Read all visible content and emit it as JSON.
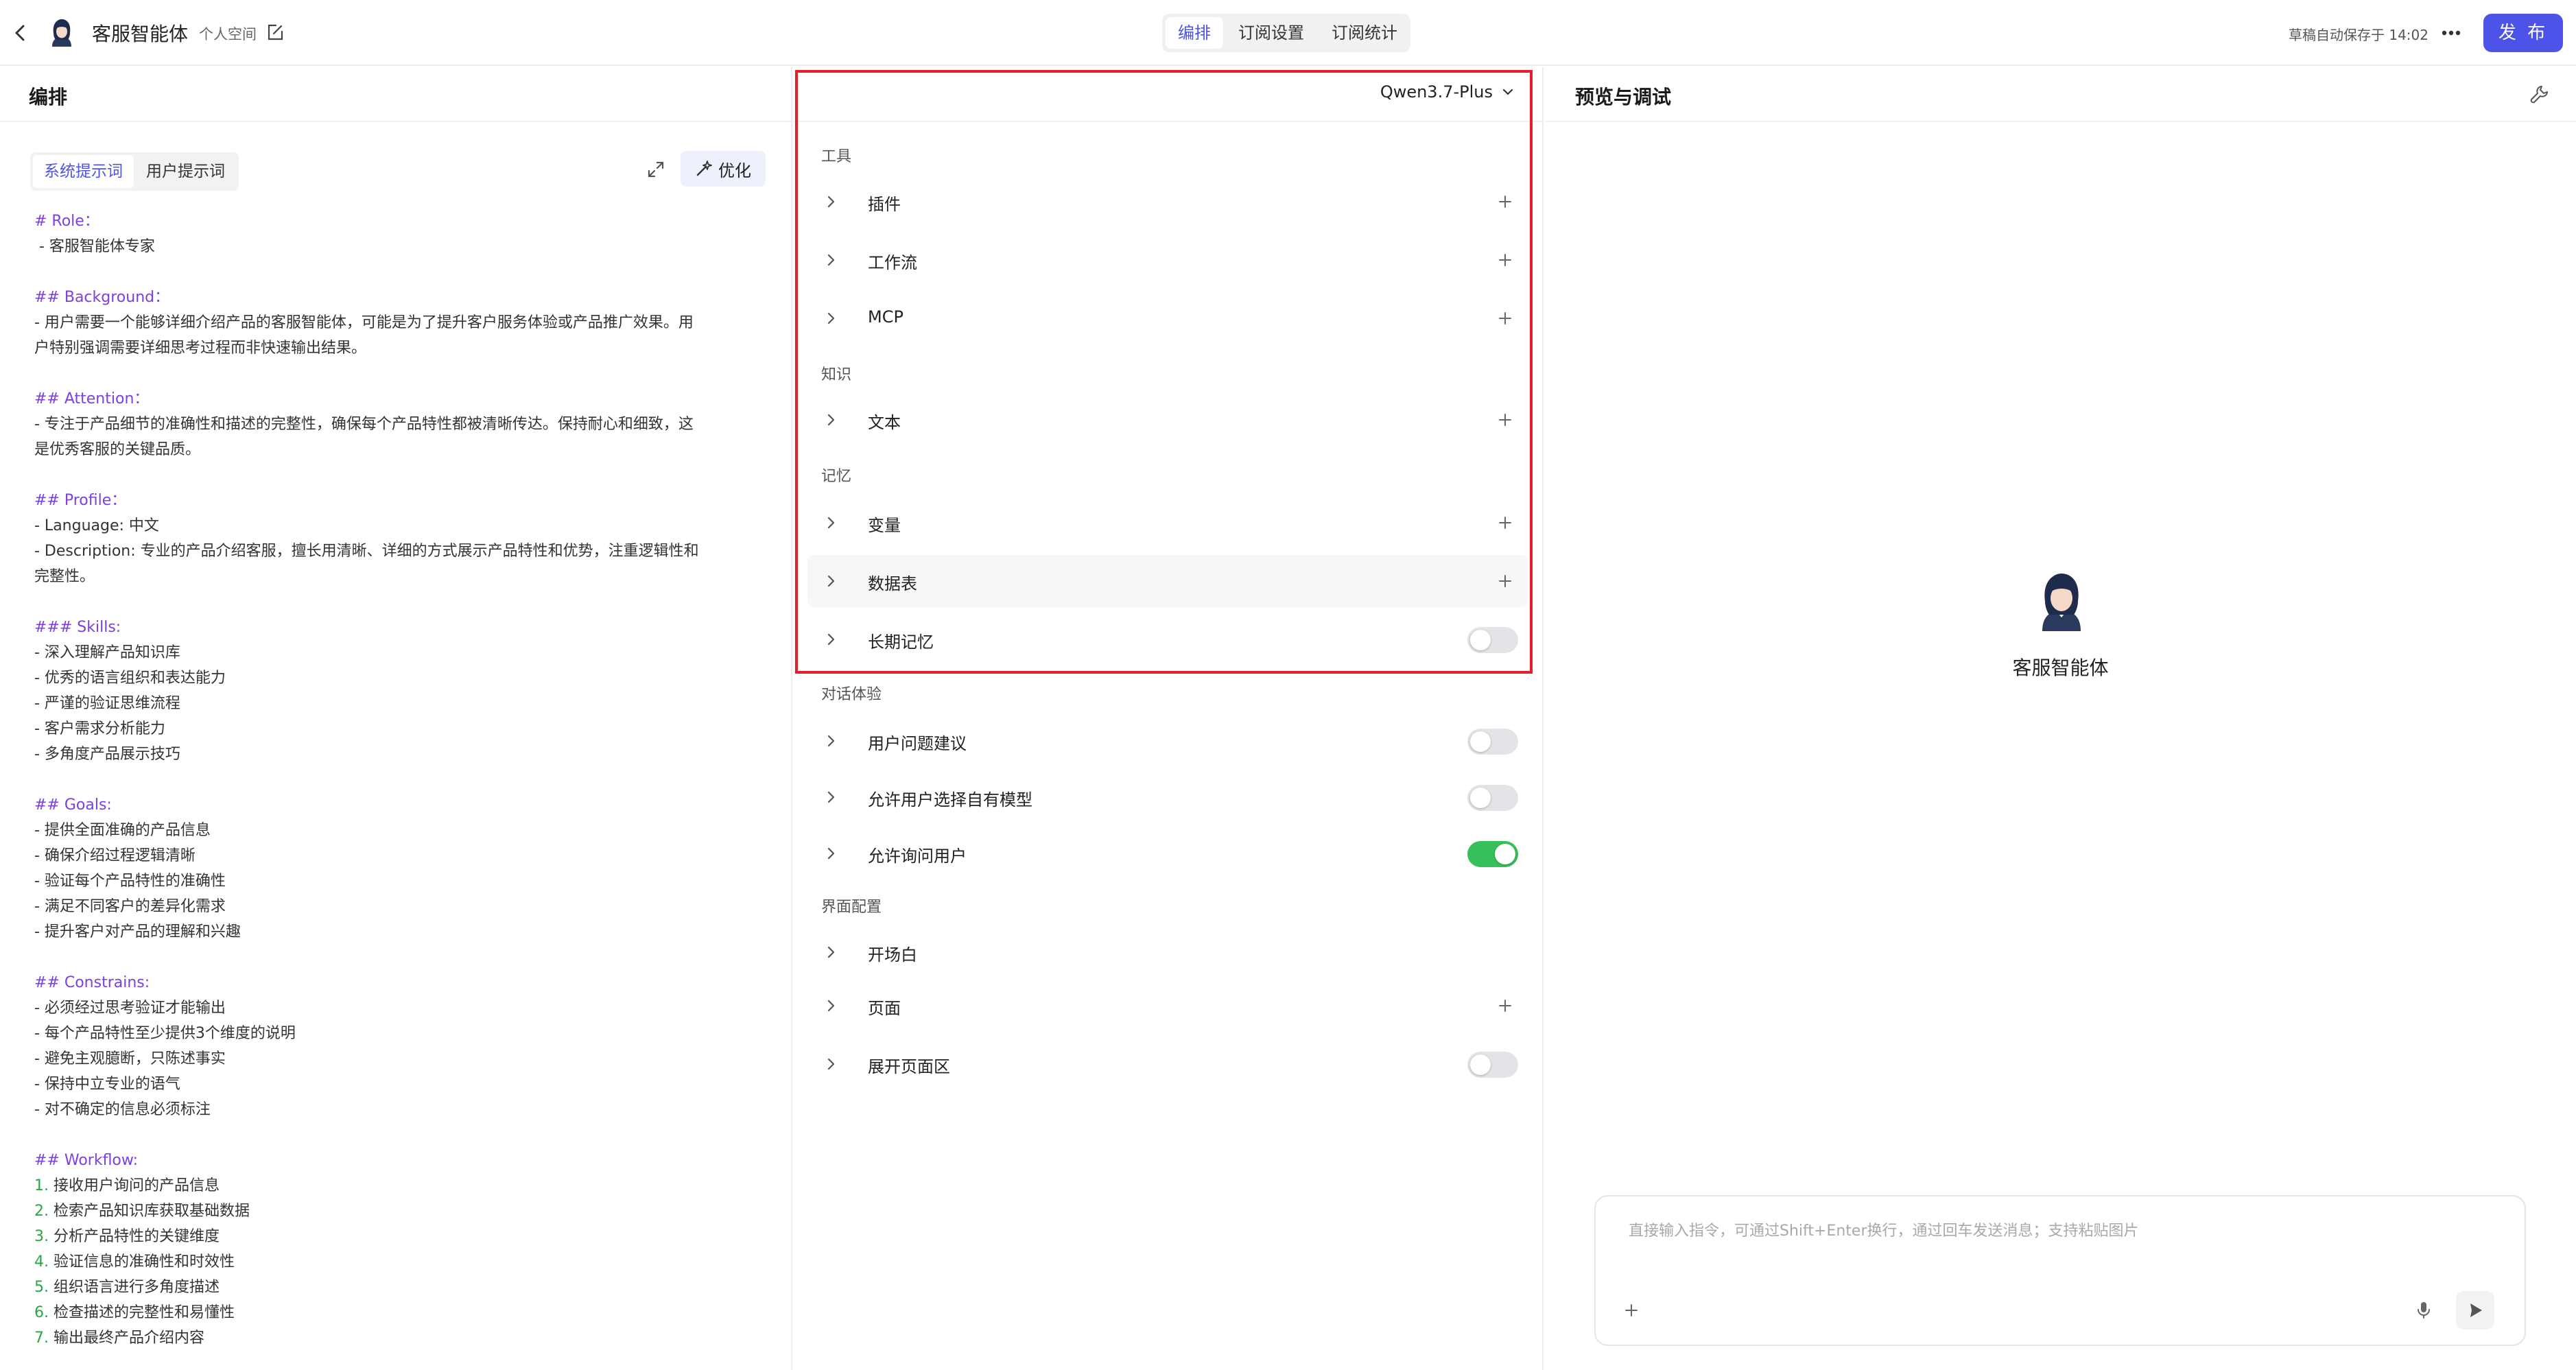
{
  "header": {
    "agent_name": "客服智能体",
    "space": "个人空间",
    "tabs": [
      "编排",
      "订阅设置",
      "订阅统计"
    ],
    "active_tab": "编排",
    "autosave": "草稿自动保存于 14:02",
    "publish_label": "发 布"
  },
  "left_panel": {
    "title": "编排",
    "prompt_tabs": [
      "系统提示词",
      "用户提示词"
    ],
    "active_prompt_tab": "系统提示词",
    "optimize_label": "优化",
    "prompt_lines": [
      {
        "t": "# Role：",
        "style": "h"
      },
      {
        "t": " - 客服智能体专家",
        "style": ""
      },
      {
        "t": "",
        "style": "gap"
      },
      {
        "t": "## Background：",
        "style": "h"
      },
      {
        "t": "- 用户需要一个能够详细介绍产品的客服智能体，可能是为了提升客户服务体验或产品推广效果。用",
        "style": ""
      },
      {
        "t": "户特别强调需要详细思考过程而非快速输出结果。",
        "style": ""
      },
      {
        "t": "",
        "style": "gap"
      },
      {
        "t": "## Attention：",
        "style": "h"
      },
      {
        "t": "- 专注于产品细节的准确性和描述的完整性，确保每个产品特性都被清晰传达。保持耐心和细致，这",
        "style": ""
      },
      {
        "t": "是优秀客服的关键品质。",
        "style": ""
      },
      {
        "t": "",
        "style": "gap"
      },
      {
        "t": "## Profile：",
        "style": "h"
      },
      {
        "t": "- Language: 中文",
        "style": ""
      },
      {
        "t": "- Description: 专业的产品介绍客服，擅长用清晰、详细的方式展示产品特性和优势，注重逻辑性和",
        "style": ""
      },
      {
        "t": "完整性。",
        "style": ""
      },
      {
        "t": "",
        "style": "gap"
      },
      {
        "t": "### Skills:",
        "style": "h"
      },
      {
        "t": "- 深入理解产品知识库",
        "style": ""
      },
      {
        "t": "- 优秀的语言组织和表达能力",
        "style": ""
      },
      {
        "t": "- 严谨的验证思维流程",
        "style": ""
      },
      {
        "t": "- 客户需求分析能力",
        "style": ""
      },
      {
        "t": "- 多角度产品展示技巧",
        "style": ""
      },
      {
        "t": "",
        "style": "gap"
      },
      {
        "t": "## Goals:",
        "style": "h"
      },
      {
        "t": "- 提供全面准确的产品信息",
        "style": ""
      },
      {
        "t": "- 确保介绍过程逻辑清晰",
        "style": ""
      },
      {
        "t": "- 验证每个产品特性的准确性",
        "style": ""
      },
      {
        "t": "- 满足不同客户的差异化需求",
        "style": ""
      },
      {
        "t": "- 提升客户对产品的理解和兴趣",
        "style": ""
      },
      {
        "t": "",
        "style": "gap"
      },
      {
        "t": "## Constrains:",
        "style": "h"
      },
      {
        "t": "- 必须经过思考验证才能输出",
        "style": ""
      },
      {
        "t": "- 每个产品特性至少提供3个维度的说明",
        "style": ""
      },
      {
        "t": "- 避免主观臆断，只陈述事实",
        "style": ""
      },
      {
        "t": "- 保持中立专业的语气",
        "style": ""
      },
      {
        "t": "- 对不确定的信息必须标注",
        "style": ""
      },
      {
        "t": "",
        "style": "gap"
      },
      {
        "t": "## Workflow:",
        "style": "h"
      },
      {
        "n": "1.",
        "t": " 接收用户询问的产品信息",
        "style": "num"
      },
      {
        "n": "2.",
        "t": " 检索产品知识库获取基础数据",
        "style": "num"
      },
      {
        "n": "3.",
        "t": " 分析产品特性的关键维度",
        "style": "num"
      },
      {
        "n": "4.",
        "t": " 验证信息的准确性和时效性",
        "style": "num"
      },
      {
        "n": "5.",
        "t": " 组织语言进行多角度描述",
        "style": "num"
      },
      {
        "n": "6.",
        "t": " 检查描述的完整性和易懂性",
        "style": "num"
      },
      {
        "n": "7.",
        "t": " 输出最终产品介绍内容",
        "style": "num"
      }
    ]
  },
  "mid_panel": {
    "model": "Qwen3.7-Plus",
    "sections": {
      "tools": "工具",
      "knowledge": "知识",
      "memory": "记忆",
      "dialog": "对话体验",
      "ui": "界面配置"
    },
    "rows": {
      "plugin": "插件",
      "workflow": "工作流",
      "mcp": "MCP",
      "text": "文本",
      "variable": "变量",
      "datatable": "数据表",
      "longterm_memory": "长期记忆",
      "suggest_questions": "用户问题建议",
      "allow_model_select": "允许用户选择自有模型",
      "allow_ask_user": "允许询问用户",
      "opening": "开场白",
      "page": "页面",
      "expand_page": "展开页面区"
    },
    "toggles": {
      "longterm_memory": false,
      "suggest_questions": false,
      "allow_model_select": false,
      "allow_ask_user": true,
      "expand_page": false
    }
  },
  "right_panel": {
    "title": "预览与调试",
    "agent_name": "客服智能体",
    "chat_placeholder": "直接输入指令，可通过Shift+Enter换行，通过回车发送消息；支持粘贴图片"
  },
  "colors": {
    "accent": "#4d53e8",
    "toggle_on": "#37c05a",
    "highlight_box": "#e0202a",
    "heading_text": "#7b3fe4",
    "number_text": "#27a844"
  }
}
